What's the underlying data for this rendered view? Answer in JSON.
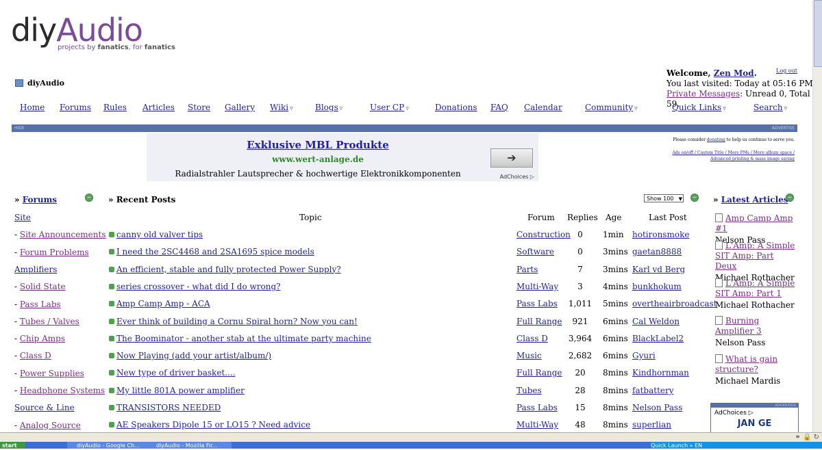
{
  "site": {
    "logo_diy": "diy",
    "logo_audio": "Audio",
    "tagline_a": "projects by ",
    "tagline_b": "fanatics",
    "tagline_c": ", for ",
    "tagline_d": "fanatics",
    "breadcrumb": "diyAudio"
  },
  "user": {
    "welcome_prefix": "Welcome, ",
    "name": "Zen Mod",
    "logout": "Log out",
    "last_visited": "You last visited: Today at 05:16 PM",
    "pm_label": "Private Messages",
    "pm_counts": ": Unread 0, Total 59."
  },
  "nav": [
    "Home",
    "Forums",
    "Rules",
    "Articles",
    "Store",
    "Gallery",
    "Wiki",
    "Blogs",
    "User CP",
    "Donations",
    "FAQ",
    "Calendar",
    "Community",
    "Quick Links",
    "Search"
  ],
  "bar": {
    "left": "HIDE",
    "right": "ADVERTISE"
  },
  "ad": {
    "title": "Exklusive MBL Produkte",
    "url": "www.wert-anlage.de",
    "desc": "Radialstrahler Lautsprecher & hochwertige Elektronikkomponenten",
    "choices": "AdChoices ▷"
  },
  "donate": {
    "text_a": "Please consider ",
    "link": "donating",
    "text_b": " to help us continue to serve you.",
    "line2": "Ads on/off / Custom Title / More PMs / More album space / Advanced printing & mass image saving"
  },
  "sections": {
    "forums": "Forums",
    "recent": "Recent Posts",
    "articles": "Latest Articles",
    "show": "Show 100"
  },
  "forum_list": [
    {
      "label": "Site",
      "cat": true
    },
    {
      "label": "Site Announcements",
      "cat": false
    },
    {
      "label": "Forum Problems",
      "cat": false
    },
    {
      "label": "Amplifiers",
      "cat": true
    },
    {
      "label": "Solid State",
      "cat": false
    },
    {
      "label": "Pass Labs",
      "cat": false
    },
    {
      "label": "Tubes / Valves",
      "cat": false
    },
    {
      "label": "Chip Amps",
      "cat": false
    },
    {
      "label": "Class D",
      "cat": false
    },
    {
      "label": "Power Supplies",
      "cat": false
    },
    {
      "label": "Headphone Systems",
      "cat": false
    },
    {
      "label": "Source & Line",
      "cat": true
    },
    {
      "label": "Analog Source",
      "cat": false
    }
  ],
  "table": {
    "headers": {
      "topic": "Topic",
      "forum": "Forum",
      "replies": "Replies",
      "age": "Age",
      "last": "Last Post"
    },
    "rows": [
      {
        "topic": "canny old valver tips",
        "forum": "Construction",
        "replies": "0",
        "age": "1min",
        "last": "hotironsmoke"
      },
      {
        "topic": "I need the 2SC4468 and 2SA1695 spice models",
        "forum": "Software",
        "replies": "0",
        "age": "3mins",
        "last": "gaetan8888"
      },
      {
        "topic": "An efficient, stable and fully protected Power Supply?",
        "forum": "Parts",
        "replies": "7",
        "age": "3mins",
        "last": "Karl vd Berg"
      },
      {
        "topic": "series crossover - what did I do wrong?",
        "forum": "Multi-Way",
        "replies": "3",
        "age": "4mins",
        "last": "bunkhokum"
      },
      {
        "topic": "Amp Camp Amp - ACA",
        "forum": "Pass Labs",
        "replies": "1,011",
        "age": "5mins",
        "last": "overtheairbroadcast"
      },
      {
        "topic": "Ever think of building a Cornu Spiral horn? Now you can!",
        "forum": "Full Range",
        "replies": "921",
        "age": "6mins",
        "last": "Cal Weldon"
      },
      {
        "topic": "The Boominator - another stab at the ultimate party machine",
        "forum": "Class D",
        "replies": "3,964",
        "age": "6mins",
        "last": "BlackLabel2"
      },
      {
        "topic": "Now Playing (add your artist/album/)",
        "forum": "Music",
        "replies": "2,682",
        "age": "6mins",
        "last": "Gyuri"
      },
      {
        "topic": "New type of driver basket....",
        "forum": "Full Range",
        "replies": "20",
        "age": "8mins",
        "last": "Kindhornman"
      },
      {
        "topic": "My little 801A power amplifier",
        "forum": "Tubes",
        "replies": "28",
        "age": "8mins",
        "last": "fatbattery"
      },
      {
        "topic": "TRANSISTORS NEEDED",
        "forum": "Pass Labs",
        "replies": "15",
        "age": "8mins",
        "last": "Nelson Pass"
      },
      {
        "topic": "AE Speakers Dipole 15 or LO15 ? Need advice",
        "forum": "Multi-Way",
        "replies": "48",
        "age": "8mins",
        "last": "superlian"
      }
    ]
  },
  "articles": [
    {
      "title": "Amp Camp Amp #1",
      "author": "Nelson Pass"
    },
    {
      "title": "L'Amp: A Simple SIT Amp: Part Deux",
      "author": "Michael Rothacher"
    },
    {
      "title": "L'Amp: A Simple SIT Amp: Part 1",
      "author": "Michael Rothacher"
    },
    {
      "title": "Burning Amplifier 3",
      "author": "Nelson Pass"
    },
    {
      "title": "What is gain structure?",
      "author": "Michael Mardis"
    }
  ],
  "ad2": {
    "choices": "AdChoices ▷",
    "text": "JAN GE"
  },
  "taskbar": {
    "start": "start",
    "t1": "diyAudio - Google Ch...",
    "t2": "diyAudio - Mozilla Fir...",
    "tray": "Quick Launch  »  EN"
  }
}
